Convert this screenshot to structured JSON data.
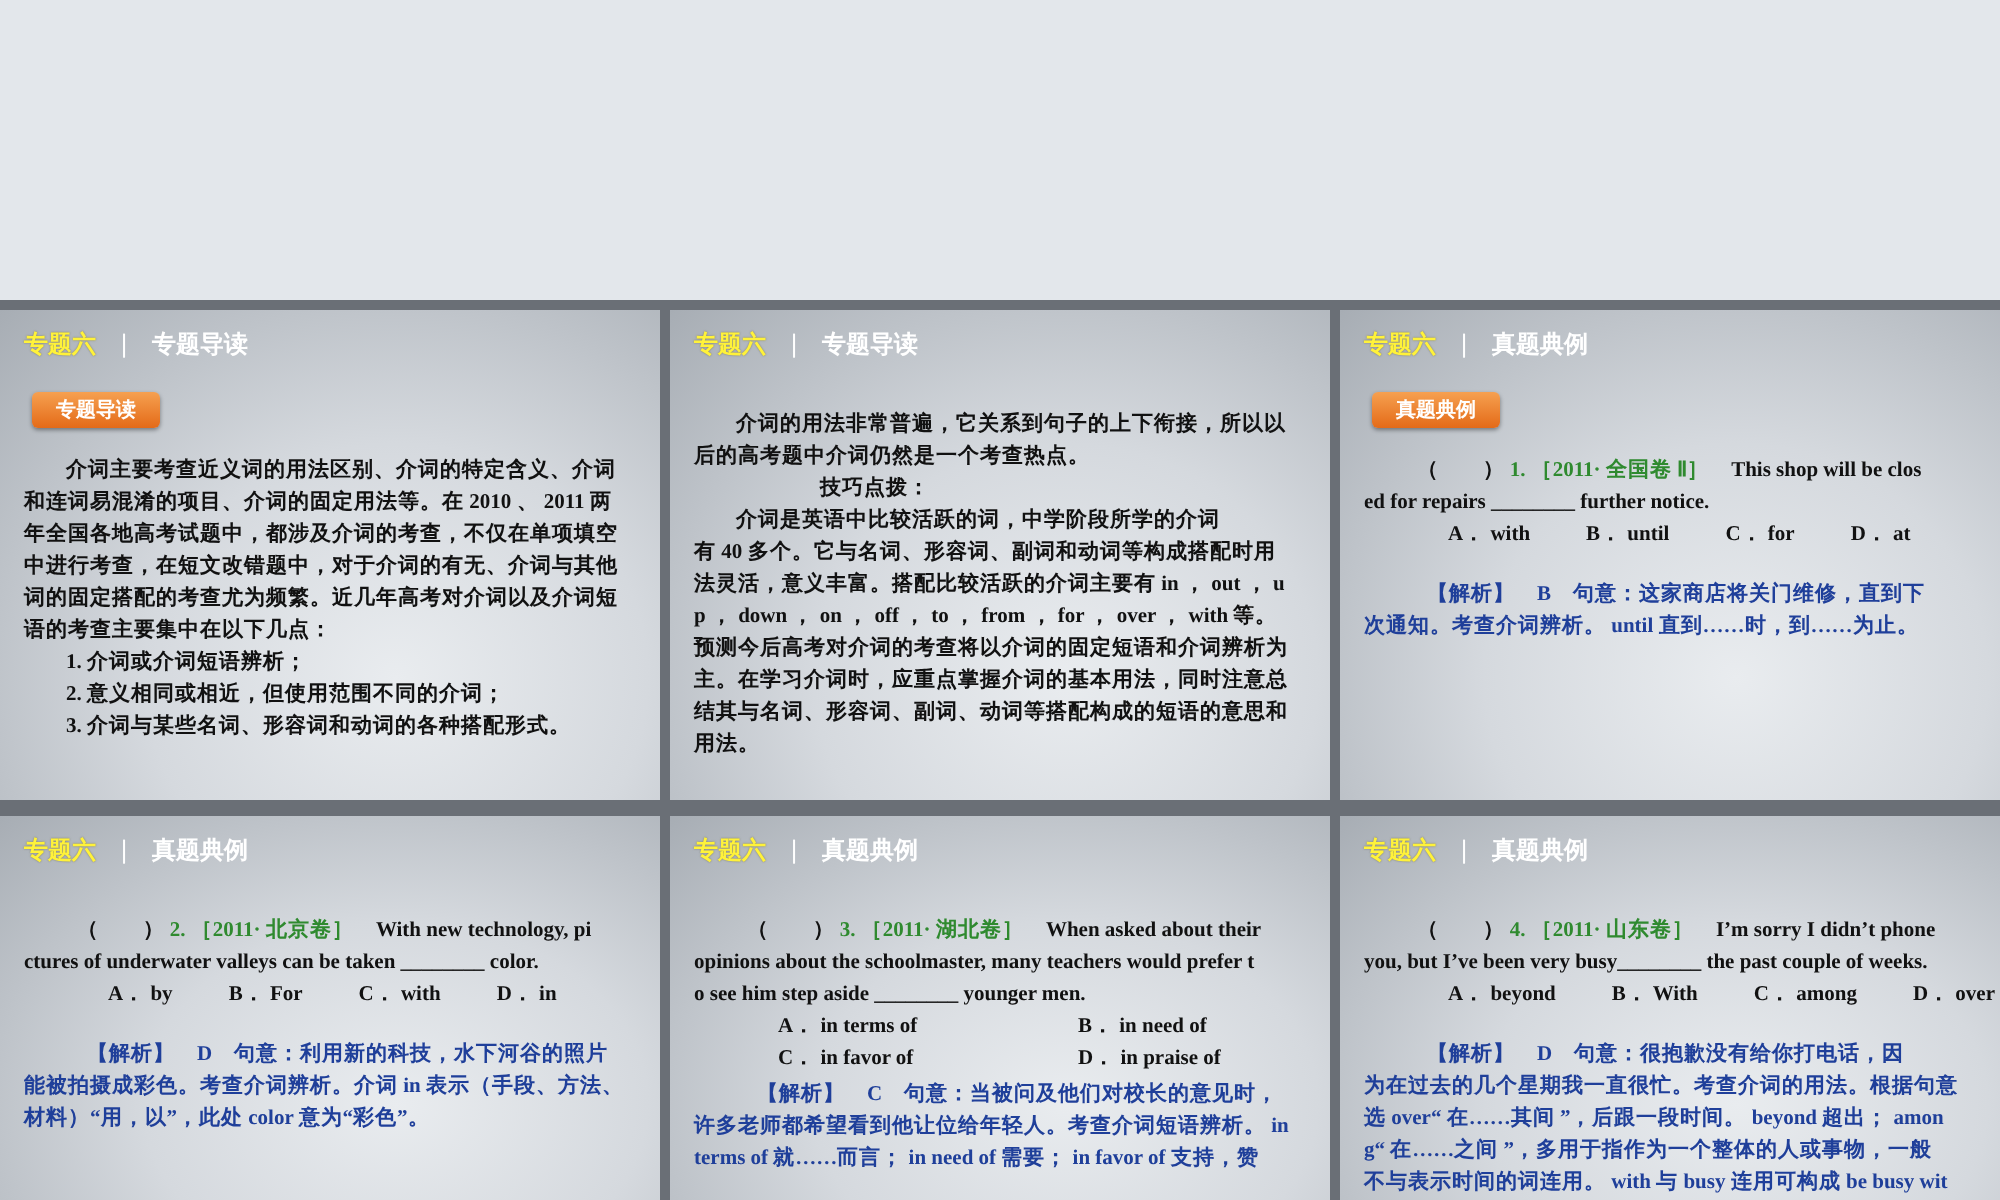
{
  "slides": [
    {
      "section": "专题六",
      "separator": "|",
      "title": "专题导读",
      "badge": "专题导读",
      "blocks": [
        {
          "kind": "para",
          "lines": [
            "介词主要考查近义词的用法区别、介词的特定含义、介词",
            "和连词易混淆的项目、介词的固定用法等。在 2010 、 2011 两",
            "年全国各地高考试题中，都涉及介词的考查，不仅在单项填空",
            "中进行考查，在短文改错题中，对于介词的有无、介词与其他",
            "词的固定搭配的考查尤为频繁。近几年高考对介词以及介词短",
            "语的考查主要集中在以下几点："
          ]
        },
        {
          "kind": "list",
          "lines": [
            "1. 介词或介词短语辨析；"
          ]
        },
        {
          "kind": "list",
          "lines": [
            "2. 意义相同或相近，但使用范围不同的介词；"
          ]
        },
        {
          "kind": "list",
          "lines": [
            "3. 介词与某些名词、形容词和动词的各种搭配形式。"
          ]
        }
      ]
    },
    {
      "section": "专题六",
      "separator": "|",
      "title": "专题导读",
      "blocks": [
        {
          "kind": "para",
          "lines": [
            "介词的用法非常普遍，它关系到句子的上下衔接，所以以",
            "后的高考题中介词仍然是一个考查热点。"
          ]
        },
        {
          "kind": "heading",
          "lines": [
            "技巧点拨："
          ]
        },
        {
          "kind": "para",
          "lines": [
            "介词是英语中比较活跃的词，中学阶段所学的介词",
            "有 40 多个。它与名词、形容词、副词和动词等构成搭配时用",
            "法灵活，意义丰富。搭配比较活跃的介词主要有 in ， out ， u",
            "p ， down ， on ， off ， to ， from ， for ， over ， with 等。",
            "预测今后高考对介词的考查将以介词的固定短语和介词辨析为",
            "主。在学习介词时，应重点掌握介词的基本用法，同时注意总",
            "结其与名词、形容词、副词、动词等搭配构成的短语的意思和",
            "用法。"
          ]
        }
      ]
    },
    {
      "section": "专题六",
      "separator": "|",
      "title": "真题典例",
      "badge": "真题典例",
      "blocks": [
        {
          "kind": "question",
          "paren": "（　　）",
          "number": "1.",
          "source": "［2011· 全国卷 Ⅱ］",
          "lines": [
            "This shop will be clos",
            "ed for repairs ________ further notice."
          ]
        },
        {
          "kind": "options",
          "rows": [
            [
              "A． with",
              "B． until",
              "C． for",
              "D． at"
            ]
          ]
        },
        {
          "kind": "analysis",
          "lines": [
            "【解析】　B　句意：这家商店将关门维修，直到下",
            "次通知。考查介词辨析。 until 直到……时，到……为止。"
          ]
        }
      ]
    },
    {
      "section": "专题六",
      "separator": "|",
      "title": "真题典例",
      "blocks": [
        {
          "kind": "question",
          "paren": "（　　）",
          "number": "2.",
          "source": "［2011· 北京卷］",
          "lines": [
            "With new technology, pi",
            "ctures of underwater valleys can be taken ________ color."
          ]
        },
        {
          "kind": "options",
          "rows": [
            [
              "A． by",
              "B． For",
              "C． with",
              "D． in"
            ]
          ]
        },
        {
          "kind": "analysis",
          "lines": [
            "【解析】　D　句意：利用新的科技，水下河谷的照片",
            "能被拍摄成彩色。考查介词辨析。介词 in 表示（手段、方法、",
            "材料）“用，以”，此处 color 意为“彩色”。"
          ]
        }
      ]
    },
    {
      "section": "专题六",
      "separator": "|",
      "title": "真题典例",
      "blocks": [
        {
          "kind": "question",
          "paren": "（　　）",
          "number": "3.",
          "source": "［2011· 湖北卷］",
          "lines": [
            "When asked about their",
            "opinions about the schoolmaster, many teachers would prefer t",
            "o see him step aside ________ younger men."
          ]
        },
        {
          "kind": "options",
          "rows": [
            [
              "A． in terms of",
              "B． in need of"
            ],
            [
              "C． in favor of",
              "D． in praise of"
            ]
          ]
        },
        {
          "kind": "analysis",
          "lines": [
            "【解析】　C　句意：当被问及他们对校长的意见时，",
            "许多老师都希望看到他让位给年轻人。考查介词短语辨析。 in",
            "terms of 就……而言； in need of 需要； in favor of 支持，赞"
          ]
        }
      ]
    },
    {
      "section": "专题六",
      "separator": "|",
      "title": "真题典例",
      "blocks": [
        {
          "kind": "question",
          "paren": "（　　）",
          "number": "4.",
          "source": "［2011· 山东卷］",
          "lines": [
            "I’m sorry I didn’t phone",
            "you, but I’ve been very busy________ the past couple of weeks."
          ]
        },
        {
          "kind": "options",
          "rows": [
            [
              "A． beyond",
              "B． With",
              "C． among",
              "D． over"
            ]
          ]
        },
        {
          "kind": "analysis",
          "lines": [
            "【解析】　D　句意：很抱歉没有给你打电话，因",
            "为在过去的几个星期我一直很忙。考查介词的用法。根据句意",
            "选 over“ 在……其间 ”，后跟一段时间。 beyond 超出； amon",
            "g“ 在……之间 ”，多用于指作为一个整体的人或事物，一般",
            "不与表示时间的词连用。 with 与 busy 连用可构成 be busy wit"
          ]
        }
      ]
    }
  ]
}
